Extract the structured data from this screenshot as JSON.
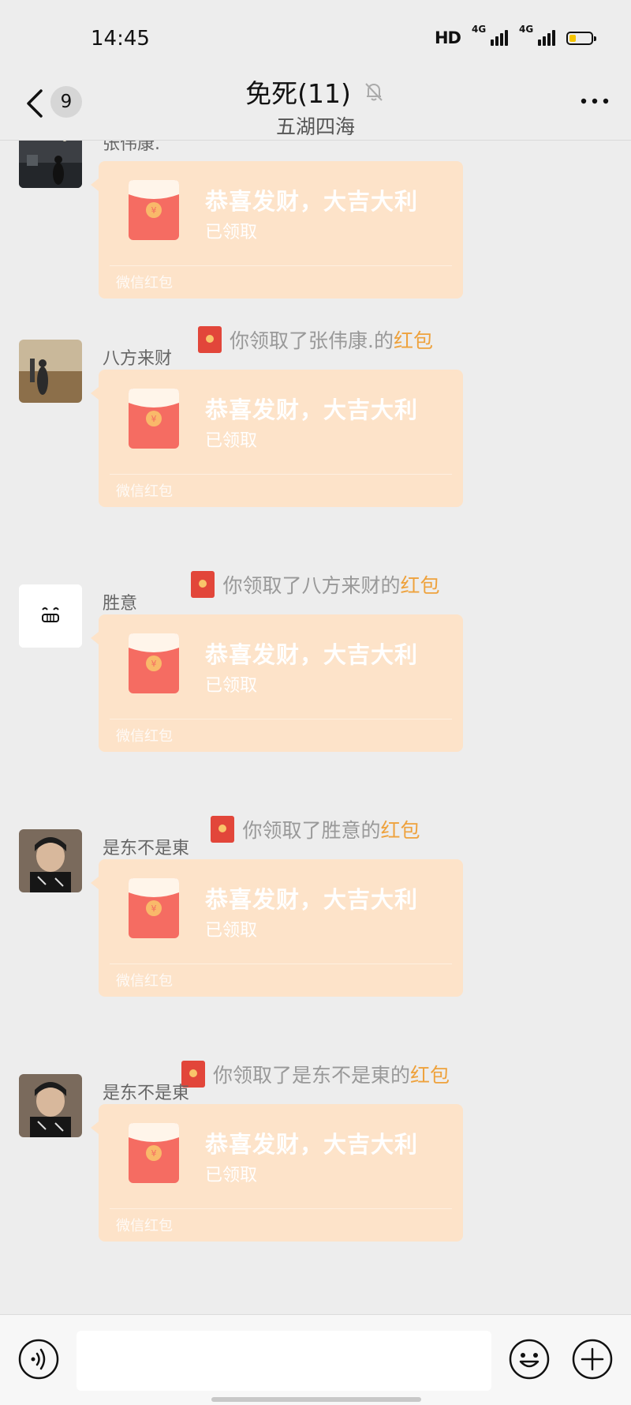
{
  "status_bar": {
    "time": "14:45",
    "hd": "HD",
    "signal_1": "4G",
    "signal_2": "4G"
  },
  "header": {
    "unread_count": "9",
    "title": "免死(11)",
    "subtitle": "五湖四海"
  },
  "messages": [
    {
      "sender": "张伟康.",
      "packet_title": "恭喜发财，大吉大利",
      "packet_status": "已领取",
      "packet_footer": "微信红包",
      "notice_prefix": "你领取了张伟康.的",
      "notice_link": "红包"
    },
    {
      "sender": "八方来财",
      "packet_title": "恭喜发财，大吉大利",
      "packet_status": "已领取",
      "packet_footer": "微信红包",
      "notice_prefix": "你领取了八方来财的",
      "notice_link": "红包"
    },
    {
      "sender": "胜意",
      "packet_title": "恭喜发财，大吉大利",
      "packet_status": "已领取",
      "packet_footer": "微信红包",
      "notice_prefix": "你领取了胜意的",
      "notice_link": "红包"
    },
    {
      "sender": "是东不是東",
      "packet_title": "恭喜发财，大吉大利",
      "packet_status": "已领取",
      "packet_footer": "微信红包",
      "notice_prefix": "你领取了是东不是東的",
      "notice_link": "红包"
    },
    {
      "sender": "是东不是東",
      "packet_title": "恭喜发财，大吉大利",
      "packet_status": "已领取",
      "packet_footer": "微信红包"
    }
  ],
  "input_bar": {
    "placeholder": ""
  },
  "colors": {
    "background": "#ededed",
    "packet": "#fde3c9",
    "envelope_red": "#f56c62",
    "notice_highlight": "#eea23d"
  },
  "icons": [
    "back-icon",
    "mute-icon",
    "more-icon",
    "red-packet-icon",
    "voice-icon",
    "emoji-icon",
    "plus-icon"
  ]
}
